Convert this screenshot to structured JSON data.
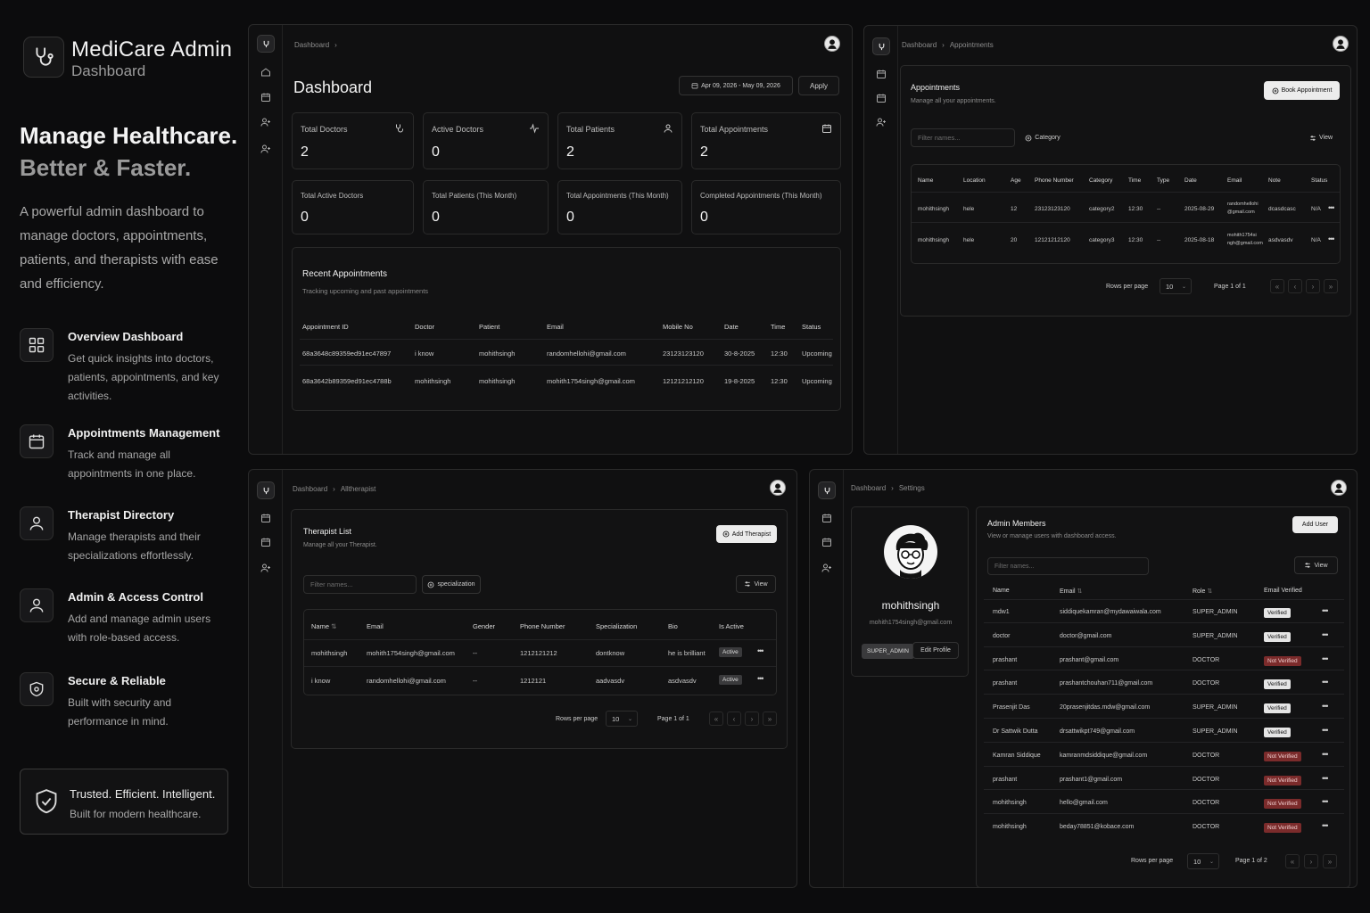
{
  "brand": {
    "title": "MediCare Admin",
    "subtitle": "Dashboard"
  },
  "hero": {
    "line1": "Manage Healthcare.",
    "line2": "Better & Faster.",
    "description": "A powerful admin dashboard to manage doctors, appointments, patients, and therapists with ease and efficiency."
  },
  "features": [
    {
      "title": "Overview Dashboard",
      "desc": "Get quick insights into doctors, patients, appointments, and key activities.",
      "icon": "grid-icon"
    },
    {
      "title": "Appointments Management",
      "desc": "Track and manage all appointments in one place.",
      "icon": "calendar-icon"
    },
    {
      "title": "Therapist Directory",
      "desc": "Manage therapists and their specializations effortlessly.",
      "icon": "user-icon"
    },
    {
      "title": "Admin & Access Control",
      "desc": "Add and manage admin users with role-based access.",
      "icon": "user-icon"
    },
    {
      "title": "Secure & Reliable",
      "desc": "Built with security and performance in mind.",
      "icon": "shield-icon"
    }
  ],
  "trust": {
    "line1": "Trusted. Efficient. Intelligent.",
    "line2": "Built for modern healthcare."
  },
  "dashboard": {
    "breadcrumb": [
      "Dashboard",
      "›"
    ],
    "title": "Dashboard",
    "date_range": "Apr 09, 2026 - May 09, 2026",
    "apply_label": "Apply",
    "stats_top": [
      {
        "label": "Total Doctors",
        "value": "2",
        "icon": "stethoscope-icon"
      },
      {
        "label": "Active Doctors",
        "value": "0",
        "icon": "activity-icon"
      },
      {
        "label": "Total Patients",
        "value": "2",
        "icon": "user-icon"
      },
      {
        "label": "Total Appointments",
        "value": "2",
        "icon": "calendar-icon"
      }
    ],
    "stats_bottom": [
      {
        "label": "Total Active Doctors",
        "value": "0"
      },
      {
        "label": "Total Patients (This Month)",
        "value": "0"
      },
      {
        "label": "Total Appointments (This Month)",
        "value": "0"
      },
      {
        "label": "Completed Appointments (This Month)",
        "value": "0"
      }
    ],
    "recent": {
      "title": "Recent Appointments",
      "subtitle": "Tracking upcoming and past appointments",
      "columns": [
        "Appointment ID",
        "Doctor",
        "Patient",
        "Email",
        "Mobile No",
        "Date",
        "Time",
        "Status"
      ],
      "rows": [
        [
          "68a3648c89359ed91ec47897",
          "i know",
          "mohithsingh",
          "randomhellohi@gmail.com",
          "23123123120",
          "30-8-2025",
          "12:30",
          "Upcoming"
        ],
        [
          "68a3642b89359ed91ec4788b",
          "mohithsingh",
          "mohithsingh",
          "mohith1754singh@gmail.com",
          "12121212120",
          "19-8-2025",
          "12:30",
          "Upcoming"
        ]
      ]
    }
  },
  "appointments": {
    "breadcrumb": [
      "Dashboard",
      "›",
      "Appointments"
    ],
    "title": "Appointments",
    "subtitle": "Manage all your appointments.",
    "book_label": "Book Appointment",
    "filter_placeholder": "Filter names...",
    "category_label": "Category",
    "view_label": "View",
    "columns": [
      "Name",
      "Location",
      "Age",
      "Phone Number",
      "Category",
      "Time",
      "Type",
      "Date",
      "Email",
      "Note",
      "Status"
    ],
    "rows": [
      [
        "mohithsingh",
        "hele",
        "12",
        "23123123120",
        "category2",
        "12:30",
        "--",
        "2025-08-29",
        "randomhellohi",
        "@gmail.com",
        "dcasdcasc",
        "N/A"
      ],
      [
        "mohithsingh",
        "hele",
        "20",
        "12121212120",
        "category3",
        "12:30",
        "--",
        "2025-08-18",
        "mohith1754si",
        "ngh@gmail.com",
        "asdvasdv",
        "N/A"
      ]
    ],
    "rows_per_page_label": "Rows per page",
    "rows_per_page": "10",
    "page_label": "Page 1 of 1"
  },
  "therapists": {
    "breadcrumb": [
      "Dashboard",
      "›",
      "Alltherapist"
    ],
    "title": "Therapist List",
    "subtitle": "Manage all your Therapist.",
    "add_label": "Add Therapist",
    "filter_placeholder": "Filter names...",
    "specialization_label": "specialization",
    "view_label": "View",
    "columns": [
      "Name",
      "Email",
      "Gender",
      "Phone Number",
      "Specialization",
      "Bio",
      "Is Active"
    ],
    "rows": [
      [
        "mohithsingh",
        "mohith1754singh@gmail.com",
        "--",
        "1212121212",
        "dontknow",
        "he is brilliant",
        "Active"
      ],
      [
        "i know",
        "randomhellohi@gmail.com",
        "--",
        "1212121",
        "aadvasdv",
        "asdvasdv",
        "Active"
      ]
    ],
    "rows_per_page_label": "Rows per page",
    "rows_per_page": "10",
    "page_label": "Page 1 of 1"
  },
  "settings": {
    "breadcrumb": [
      "Dashboard",
      "›",
      "Settings"
    ],
    "profile": {
      "name": "mohithsingh",
      "email": "mohith1754singh@gmail.com",
      "role": "SUPER_ADMIN",
      "edit_label": "Edit Profile"
    },
    "title": "Admin Members",
    "subtitle": "View or manage users with dashboard access.",
    "add_label": "Add User",
    "filter_placeholder": "Filter names...",
    "view_label": "View",
    "columns": [
      "Name",
      "Email",
      "Role",
      "Email Verified"
    ],
    "rows": [
      [
        "mdw1",
        "siddiquekamran@mydawaiwala.com",
        "SUPER_ADMIN",
        "Verified"
      ],
      [
        "doctor",
        "doctor@gmail.com",
        "SUPER_ADMIN",
        "Verified"
      ],
      [
        "prashant",
        "prashant@gmail.com",
        "DOCTOR",
        "Not Verified"
      ],
      [
        "prashant",
        "prashantchouhan711@gmail.com",
        "DOCTOR",
        "Verified"
      ],
      [
        "Prasenjit Das",
        "20prasenjitdas.mdw@gmail.com",
        "SUPER_ADMIN",
        "Verified"
      ],
      [
        "Dr Sattwik Dutta",
        "drsattwikpt749@gmail.com",
        "SUPER_ADMIN",
        "Verified"
      ],
      [
        "Kamran Siddique",
        "kamranmdsiddique@gmail.com",
        "DOCTOR",
        "Not Verified"
      ],
      [
        "prashant",
        "prashant1@gmail.com",
        "DOCTOR",
        "Not Verified"
      ],
      [
        "mohithsingh",
        "hello@gmail.com",
        "DOCTOR",
        "Not Verified"
      ],
      [
        "mohithsingh",
        "beday78851@kobace.com",
        "DOCTOR",
        "Not Verified"
      ]
    ],
    "rows_per_page_label": "Rows per page",
    "rows_per_page": "10",
    "page_label": "Page 1 of 2"
  },
  "colors": {
    "background": "#0c0c0d",
    "panel": "#101011",
    "not_verified": "#7b2b2b",
    "verified": "#e5e5e5"
  }
}
